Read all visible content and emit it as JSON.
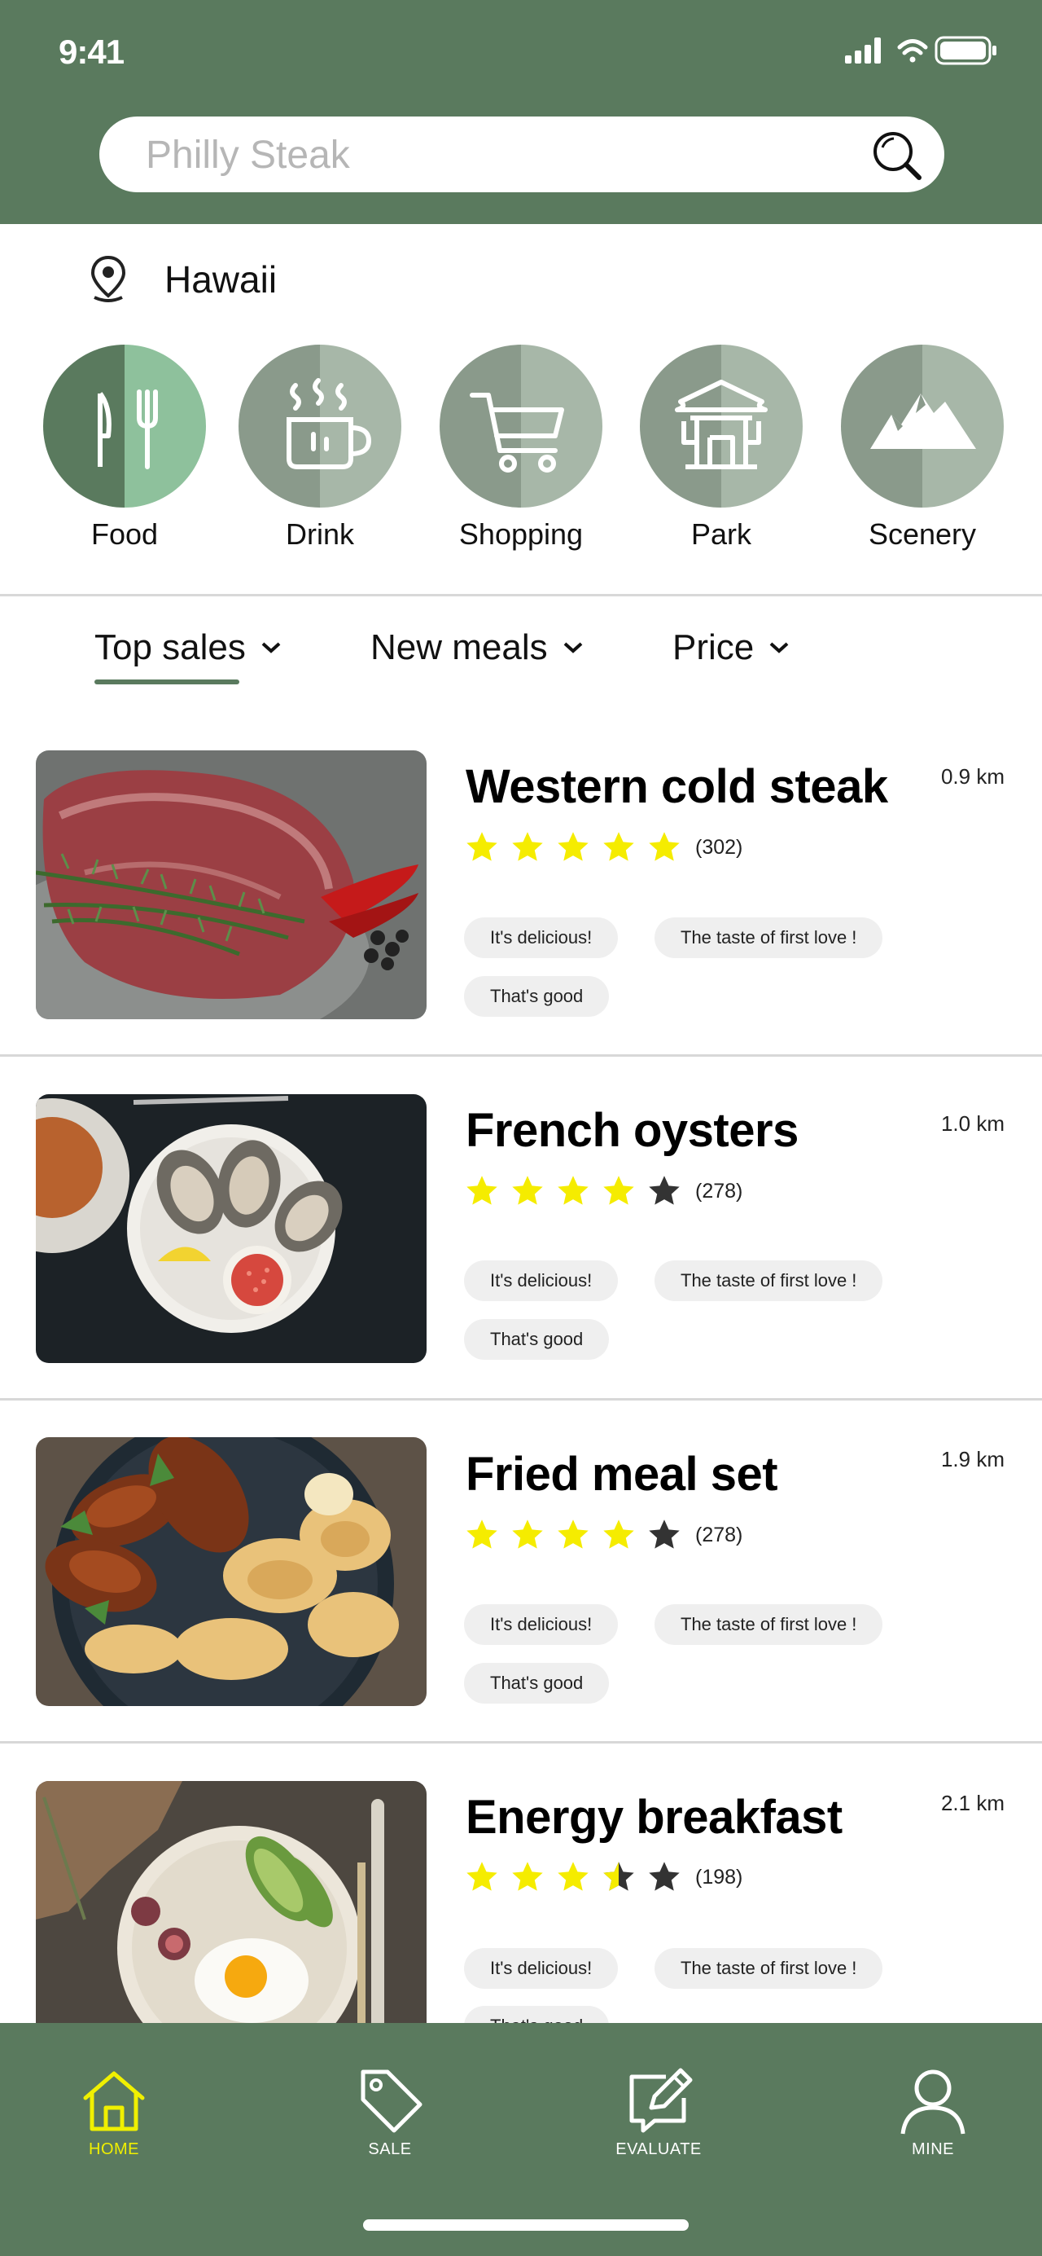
{
  "status_bar": {
    "time": "9:41"
  },
  "search": {
    "placeholder": "Philly Steak"
  },
  "location": {
    "name": "Hawaii"
  },
  "categories": [
    {
      "label": "Food",
      "icon": "fork-knife-icon",
      "left": "#5a7a5e",
      "right": "#8ec19c"
    },
    {
      "label": "Drink",
      "icon": "coffee-cup-icon",
      "left": "#8a9a8b",
      "right": "#a7b7a8"
    },
    {
      "label": "Shopping",
      "icon": "shopping-cart-icon",
      "left": "#8a9a8b",
      "right": "#a7b7a8"
    },
    {
      "label": "Park",
      "icon": "pavilion-icon",
      "left": "#8a9a8b",
      "right": "#a7b7a8"
    },
    {
      "label": "Scenery",
      "icon": "mountain-icon",
      "left": "#8a9a8b",
      "right": "#a7b7a8"
    }
  ],
  "sort_tabs": [
    {
      "label": "Top sales",
      "active": true
    },
    {
      "label": "New meals",
      "active": false
    },
    {
      "label": "Price",
      "active": false
    }
  ],
  "items": [
    {
      "title": "Western cold steak",
      "distance": "0.9 km",
      "rating": 5,
      "reviews": "(302)",
      "tags": [
        "It's delicious!",
        "The taste of first love !",
        "That's good"
      ],
      "image": "steak-photo"
    },
    {
      "title": "French oysters",
      "distance": "1.0 km",
      "rating": 4,
      "reviews": "(278)",
      "tags": [
        "It's delicious!",
        "The taste of first love !",
        "That's good"
      ],
      "image": "oysters-photo"
    },
    {
      "title": "Fried meal set",
      "distance": "1.9 km",
      "rating": 4,
      "reviews": "(278)",
      "tags": [
        "It's delicious!",
        "The taste of first love !",
        "That's good"
      ],
      "image": "fried-chicken-photo"
    },
    {
      "title": "Energy breakfast",
      "distance": "2.1 km",
      "rating": 3.5,
      "reviews": "(198)",
      "tags": [
        "It's delicious!",
        "The taste of first love !",
        "That's good"
      ],
      "image": "breakfast-photo"
    }
  ],
  "bottom_nav": [
    {
      "label": "HOME",
      "icon": "home-icon",
      "active": true
    },
    {
      "label": "SALE",
      "icon": "price-tag-icon",
      "active": false
    },
    {
      "label": "EVALUATE",
      "icon": "edit-note-icon",
      "active": false
    },
    {
      "label": "MINE",
      "icon": "user-icon",
      "active": false
    }
  ],
  "colors": {
    "brand_green": "#5a7a5e",
    "star_yellow": "#f5ec00",
    "star_empty": "#333333",
    "nav_active": "#f0f000"
  }
}
